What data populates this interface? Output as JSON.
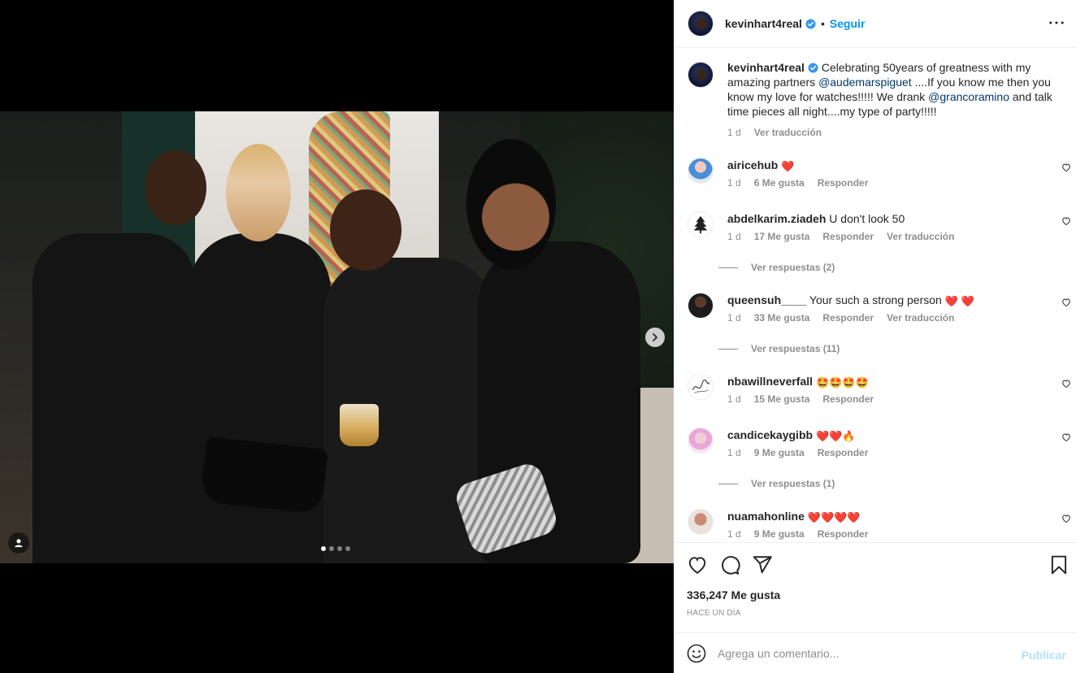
{
  "post": {
    "username": "kevinhart4real",
    "separator": "•",
    "follow_label": "Seguir",
    "caption_parts": [
      "Celebrating 50years of greatness with my amazing partners ",
      "@audemarspiguet",
      " ....If you know me then you know my love for watches!!!!! We drank ",
      "@grancoramino",
      " and talk time pieces all night....my type of party!!!!!"
    ],
    "caption_age": "1 d",
    "caption_translate": "Ver traducción",
    "carousel_dots": 4,
    "carousel_active": 0
  },
  "comments": [
    {
      "user": "airicehub",
      "text": "",
      "emoji": "❤️",
      "age": "1 d",
      "likes": "6 Me gusta",
      "reply": "Responder",
      "translate": ""
    },
    {
      "user": "abdelkarim.ziadeh",
      "text": "U don't look 50",
      "emoji": "",
      "age": "1 d",
      "likes": "17 Me gusta",
      "reply": "Responder",
      "translate": "Ver traducción",
      "replies": "Ver respuestas (2)"
    },
    {
      "user": "queensuh____",
      "text": "Your such a strong person",
      "emoji": "❤️ ❤️",
      "age": "1 d",
      "likes": "33 Me gusta",
      "reply": "Responder",
      "translate": "Ver traducción",
      "replies": "Ver respuestas (11)"
    },
    {
      "user": "nbawillneverfall",
      "text": "",
      "emoji": "🤩🤩🤩🤩",
      "age": "1 d",
      "likes": "15 Me gusta",
      "reply": "Responder",
      "translate": ""
    },
    {
      "user": "candicekaygibb",
      "text": "",
      "emoji": "❤️❤️🔥",
      "age": "1 d",
      "likes": "9 Me gusta",
      "reply": "Responder",
      "translate": "",
      "replies": "Ver respuestas (1)"
    },
    {
      "user": "nuamahonline",
      "text": "",
      "emoji": "❤️❤️❤️❤️",
      "age": "1 d",
      "likes": "9 Me gusta",
      "reply": "Responder",
      "translate": ""
    }
  ],
  "actions": {
    "likes_count": "336,247 Me gusta",
    "posted_when": "Hace un día",
    "comment_placeholder": "Agrega un comentario...",
    "publish_label": "Publicar"
  },
  "icons": {
    "verified": "verified-badge-icon",
    "more": "more-options-icon",
    "next": "chevron-right-icon",
    "tag": "user-tag-icon",
    "like": "heart-icon",
    "comment": "comment-icon",
    "share": "paper-plane-icon",
    "save": "bookmark-icon",
    "emoji": "emoji-icon"
  },
  "colors": {
    "accent": "#0095f6",
    "mention": "#00376b",
    "muted": "#8e8e8e",
    "verified": "#3897f0",
    "publish_disabled": "#b2dffc"
  }
}
